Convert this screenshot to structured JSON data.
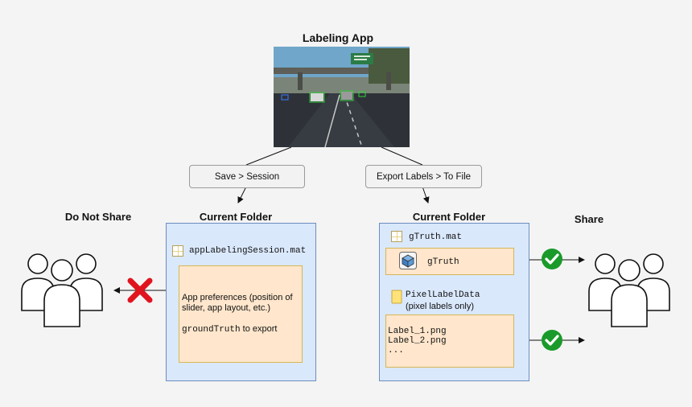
{
  "app_title": "Labeling App",
  "steps": {
    "save": "Save > Session",
    "export": "Export Labels > To File"
  },
  "left": {
    "group_label": "Do Not Share",
    "folder_label": "Current Folder",
    "session_file": "appLabelingSession.mat",
    "note_line1": "App preferences (position of",
    "note_line2": "slider, app layout, etc.)",
    "note_code": "groundTruth",
    "note_code_suffix": " to export"
  },
  "right": {
    "group_label": "Share",
    "folder_label": "Current Folder",
    "gtruth_file": "gTruth.mat",
    "gtruth_var": "gTruth",
    "pixel_folder": "PixelLabelData",
    "pixel_desc": "(pixel labels only)",
    "files": [
      "Label_1.png",
      "Label_2.png",
      "..."
    ]
  },
  "colors": {
    "folder_fill": "#dae8fc",
    "folder_border": "#6c8ebf",
    "note_fill": "#ffe6cc",
    "note_border": "#d6b656",
    "check_green": "#1a9a2a",
    "cross_red": "#e0141e"
  },
  "icons": [
    "people-group-icon",
    "red-x-icon",
    "green-check-icon",
    "mat-file-icon",
    "variable-cube-icon",
    "folder-icon"
  ]
}
